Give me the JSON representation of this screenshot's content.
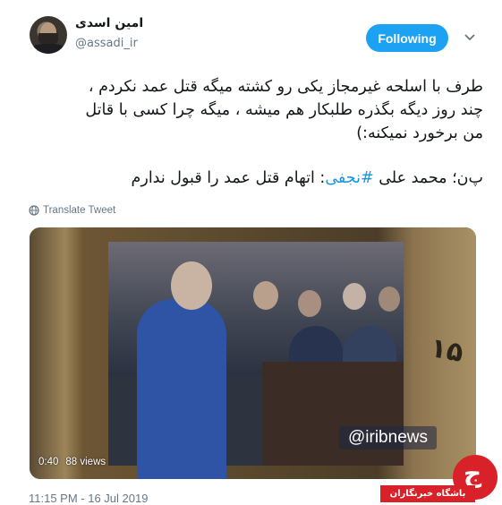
{
  "author": {
    "name": "امین اسدی",
    "handle": "@assadi_ir"
  },
  "follow_button": {
    "label": "Following",
    "color": "#1da1f2"
  },
  "tweet": {
    "para1_line1": "طرف با اسلحه غیرمجاز یکی رو کشته میگه قتل عمد نکردم ،",
    "para1_line2": "چند روز دیگه بگذره طلبکار هم میشه ، میگه چرا کسی با قاتل",
    "para1_line3": "من برخورد نمیکنه:)",
    "para2_prefix": "پ‌ن؛ محمد علی ",
    "para2_hashtag": "#نجفی",
    "para2_suffix": ": اتهام قتل عمد را قبول ندارم",
    "hashtag_color": "#1b95e0"
  },
  "translate": {
    "label": "Translate Tweet",
    "icon": "globe-icon"
  },
  "video": {
    "duration": "0:40",
    "views": "88 views",
    "brand": "@iribnews",
    "frame_number": "۱۵"
  },
  "timestamp": "11:15 PM - 16 Jul 2019",
  "watermark": {
    "label": "باشگاه خبرنگاران",
    "glyph": "ج",
    "color": "#d82128"
  }
}
